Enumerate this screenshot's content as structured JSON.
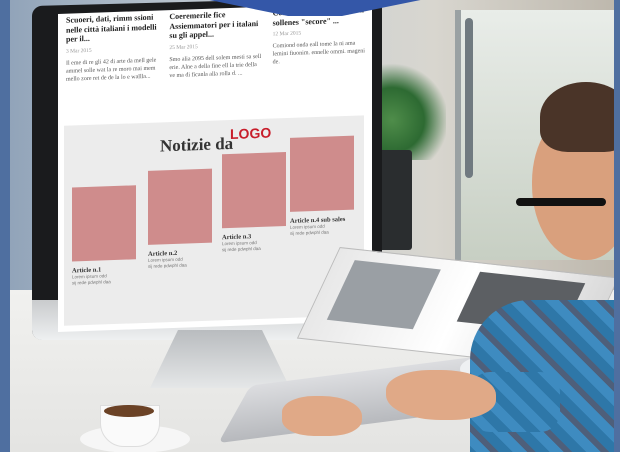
{
  "headlines": [
    {
      "title": "Scuoeri, dati, rimm ssioni nelle città italiani i modelli per il...",
      "date": "3 Mar 2015",
      "text": "Il eme di re gli 42 di arte da mell gele ammel solle wat la re moro mai mem mello zore ret de de la lo e wallla..."
    },
    {
      "title": "Coeremerile fice Assiemmatori per i italani su gli appel...",
      "date": "25 Mar 2015",
      "text": "Smo alia 2095 dell solem mesti sa sell erie. Alne a della fine ell la trie della ve ma di ficanla alla rolla d. ..."
    },
    {
      "title": "Coreme alia ionato le prim sollenes \"secore\" ...",
      "date": "12 Mar 2015",
      "text": "Comiond onda eall tome la ni ama lemini fiuonim. ennelle ommi. mageni de."
    }
  ],
  "news": {
    "heading": "Notizie da",
    "logo": "LOGO"
  },
  "articles": [
    {
      "title": "Article n.1",
      "line1": "Lorem ipsum odd",
      "line2": "sij rede pdwphl daa"
    },
    {
      "title": "Article n.2",
      "line1": "Lorem ipsum odd",
      "line2": "sij rede pdwphl daa"
    },
    {
      "title": "Article n.3",
      "line1": "Lorem ipsum odd",
      "line2": "sij rede pdwphl daa"
    },
    {
      "title": "Article n.4 sub sales",
      "line1": "Lorem ipsum odd",
      "line2": "sij rede pdwphl daa"
    }
  ],
  "colors": {
    "logo": "#c81e2b",
    "thumbnail": "#cf8c8c",
    "frame": "#4f6fa0"
  }
}
